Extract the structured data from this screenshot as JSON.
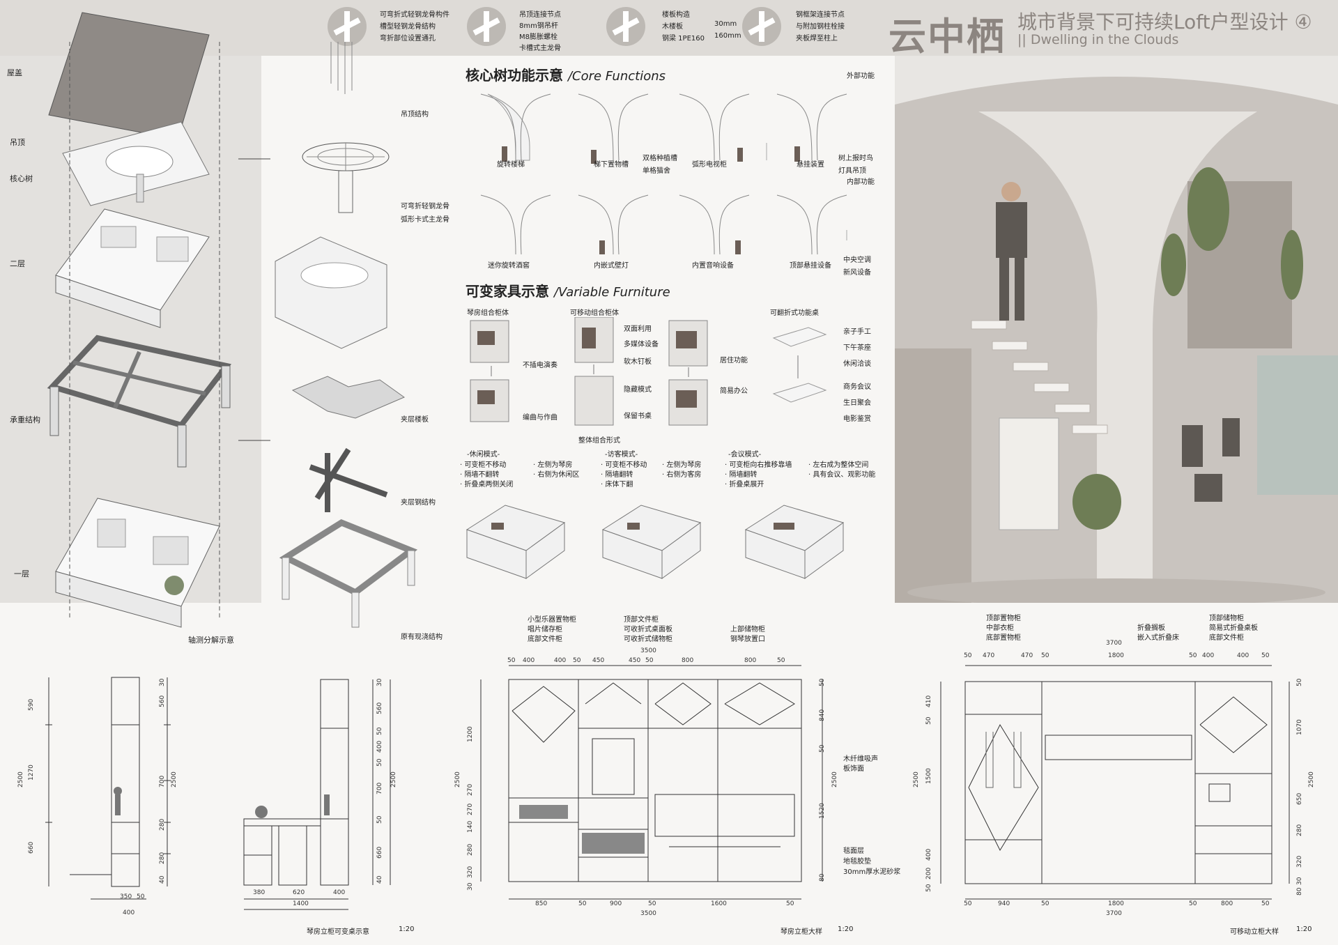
{
  "title": {
    "zh": "云中栖",
    "sub": "城市背景下可持续Loft户型设计 ④",
    "en": "|| Dwelling in the Clouds"
  },
  "nodes": [
    {
      "lines": [
        "可弯折式轻钢龙骨构件",
        "槽型轻钢龙骨结构",
        "弯折部位设置通孔"
      ]
    },
    {
      "lines": [
        "吊顶连接节点",
        "8mm钢吊杆",
        "M8膨胀螺栓",
        "卡槽式主龙骨"
      ]
    },
    {
      "lines": [
        "楼板构造",
        "木楼板",
        "钢梁  1PE160"
      ],
      "values": [
        "30mm",
        "160mm"
      ]
    },
    {
      "lines": [
        "钢框架连接节点",
        "与附加钢柱栓接",
        "夹板焊至柱上"
      ]
    }
  ],
  "axo": {
    "levels": [
      "屋盖",
      "吊顶",
      "核心树",
      "二层",
      "承重结构",
      "一层"
    ],
    "caption": "轴测分解示意",
    "labels": [
      "吊顶结构",
      "可弯折轻钢龙骨",
      "弧形卡式主龙骨",
      "夹层楼板",
      "夹层钢结构",
      "原有现浇结构"
    ]
  },
  "core": {
    "title_zh": "核心树功能示意",
    "title_en": "/Core Functions",
    "outer_label": "外部功能",
    "inner_label": "内部功能",
    "row1": [
      "旋转楼梯",
      "梯下置物槽",
      "弧形电视柜",
      "悬挂装置"
    ],
    "row1_notes": [
      "双格种植槽",
      "单格猫舍",
      "树上报时鸟",
      "灯具吊顶"
    ],
    "row2": [
      "迷你旋转酒窖",
      "内嵌式壁灯",
      "内置音响设备",
      "顶部悬挂设备"
    ],
    "row2_notes": [
      "中央空调",
      "新风设备"
    ]
  },
  "furniture": {
    "title_zh": "可变家具示意",
    "title_en": "/Variable Furniture",
    "groups": [
      "琴房组合柜体",
      "可移动组合柜体",
      "可翻折式功能桌"
    ],
    "piano_modes": [
      "不插电演奏",
      "编曲与作曲"
    ],
    "movable_a": [
      "双面利用",
      "多媒体设备",
      "软木钉板"
    ],
    "movable_b": [
      "隐藏模式",
      "保留书桌"
    ],
    "movable_c": [
      "居住功能",
      "简易办公"
    ],
    "table_a": [
      "亲子手工",
      "下午茶座",
      "休闲洽谈"
    ],
    "table_b": [
      "商务会议",
      "生日聚会",
      "电影鉴赏"
    ],
    "combo_label": "整体组合形式",
    "modes": [
      {
        "name": "-休闲模式-",
        "lines": [
          "· 可变柜不移动",
          "· 隔墙不翻转",
          "· 折叠桌两侧关闭"
        ],
        "lines2": [
          "· 左侧为琴房",
          "· 右侧为休闲区"
        ]
      },
      {
        "name": "-访客模式-",
        "lines": [
          "· 可变柜不移动",
          "· 隔墙翻转",
          "· 床体下翻"
        ],
        "lines2": [
          "· 左侧为琴房",
          "· 右侧为客房"
        ]
      },
      {
        "name": "-会议模式-",
        "lines": [
          "· 可变柜向右推移靠墙",
          "· 隔墙翻转",
          "· 折叠桌展开"
        ],
        "lines2": [
          "· 左右成为整体空间",
          "· 具有会议、观影功能"
        ]
      }
    ]
  },
  "drawings": {
    "d1": {
      "caption": "琴房立柜可变桌示意",
      "scale": "1:20",
      "dims_v": [
        "590",
        "1270",
        "660",
        "2500"
      ],
      "dims_v_r": [
        "560",
        "700",
        "280",
        "280",
        "40",
        "2500",
        "30"
      ],
      "dims_h": [
        "350",
        "50",
        "400"
      ]
    },
    "d2": {
      "dims_v": [
        "30",
        "560",
        "50",
        "400",
        "50",
        "700",
        "50",
        "660",
        "40",
        "2500"
      ],
      "dims_h": [
        "380",
        "620",
        "400",
        "1400"
      ]
    },
    "d3": {
      "caption": "琴房立柜大样",
      "scale": "1:20",
      "notes_top": [
        [
          "小型乐器置物柜",
          "唱片储存柜",
          "底部文件柜"
        ],
        [
          "顶部文件柜",
          "可收折式桌面板",
          "可收折式储物柜"
        ],
        [
          "上部储物柜",
          "钢琴放置口"
        ]
      ],
      "dims_top": [
        "3500",
        "50",
        "400",
        "400",
        "50",
        "450",
        "450",
        "50",
        "800",
        "800",
        "50"
      ],
      "dims_bottom": [
        "850",
        "50",
        "900",
        "50",
        "1600",
        "50",
        "3500"
      ],
      "dims_v_l": [
        "1200",
        "2500",
        "270",
        "270",
        "140",
        "280",
        "320",
        "30"
      ],
      "dims_v_r": [
        "50",
        "840",
        "50",
        "2500",
        "1520",
        "80"
      ],
      "notes_right": [
        "木纤维吸声",
        "板饰面",
        "毯面层",
        "地毯胶垫",
        "30mm厚水泥砂浆"
      ]
    },
    "d4": {
      "caption": "可移动立柜大样",
      "scale": "1:20",
      "notes_top": [
        [
          "顶部置物柜",
          "中部衣柜",
          "底部置物柜"
        ],
        [
          "折叠搁板",
          "嵌入式折叠床"
        ],
        [
          "顶部储物柜",
          "简易式折叠桌板",
          "底部文件柜"
        ]
      ],
      "dims_top": [
        "3700",
        "50",
        "470",
        "470",
        "50",
        "1800",
        "50",
        "400",
        "400",
        "50"
      ],
      "dims_bottom": [
        "50",
        "940",
        "50",
        "1800",
        "50",
        "800",
        "50",
        "3700"
      ],
      "dims_v_l": [
        "410",
        "50",
        "1500",
        "2500",
        "400",
        "200",
        "50"
      ],
      "dims_v_r": [
        "50",
        "1070",
        "2500",
        "650",
        "280",
        "320",
        "30",
        "80"
      ]
    }
  },
  "colors": {
    "accent": "#8c8580",
    "panel": "#e3e1de",
    "band": "#dedbd7"
  }
}
